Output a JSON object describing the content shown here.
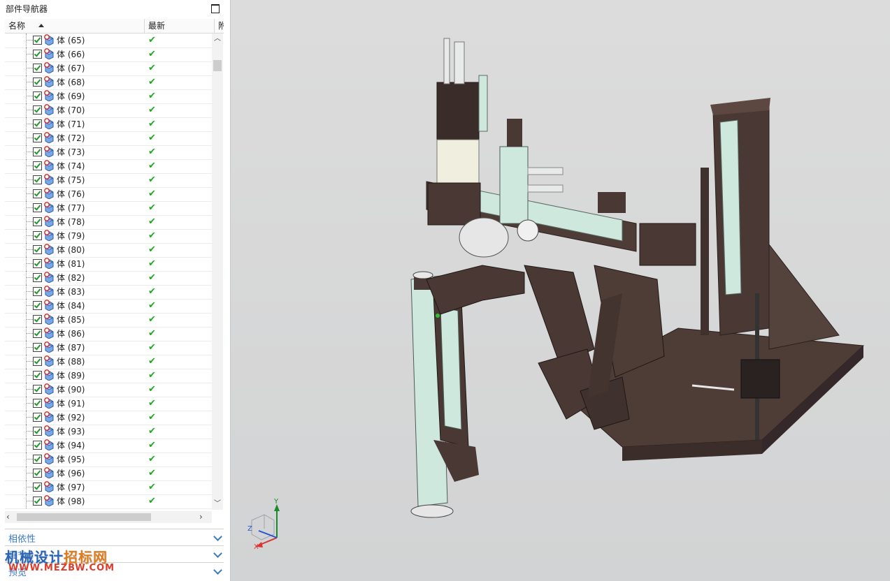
{
  "navigator": {
    "title": "部件导航器",
    "columns": [
      "名称",
      "最新",
      "附"
    ]
  },
  "tree_rows": [
    {
      "label": "体 (65)"
    },
    {
      "label": "体 (66)"
    },
    {
      "label": "体 (67)"
    },
    {
      "label": "体 (68)"
    },
    {
      "label": "体 (69)"
    },
    {
      "label": "体 (70)"
    },
    {
      "label": "体 (71)"
    },
    {
      "label": "体 (72)"
    },
    {
      "label": "体 (73)"
    },
    {
      "label": "体 (74)"
    },
    {
      "label": "体 (75)"
    },
    {
      "label": "体 (76)"
    },
    {
      "label": "体 (77)"
    },
    {
      "label": "体 (78)"
    },
    {
      "label": "体 (79)"
    },
    {
      "label": "体 (80)"
    },
    {
      "label": "体 (81)"
    },
    {
      "label": "体 (82)"
    },
    {
      "label": "体 (83)"
    },
    {
      "label": "体 (84)"
    },
    {
      "label": "体 (85)"
    },
    {
      "label": "体 (86)"
    },
    {
      "label": "体 (87)"
    },
    {
      "label": "体 (88)"
    },
    {
      "label": "体 (89)"
    },
    {
      "label": "体 (90)"
    },
    {
      "label": "体 (91)"
    },
    {
      "label": "体 (92)"
    },
    {
      "label": "体 (93)"
    },
    {
      "label": "体 (94)"
    },
    {
      "label": "体 (95)"
    },
    {
      "label": "体 (96)"
    },
    {
      "label": "体 (97)"
    },
    {
      "label": "体 (98)"
    }
  ],
  "panels": [
    {
      "label": "相依性"
    },
    {
      "label": "细节"
    },
    {
      "label": "预览"
    }
  ],
  "watermark": {
    "line1_a": "机械设计",
    "line1_b": "招标网",
    "line2": "WWW.MEZBW.COM"
  },
  "triad": {
    "x": "X",
    "y": "Y",
    "z": "Z"
  },
  "colors": {
    "panel_link": "#3a78c4",
    "check": "#1fa61f",
    "model_body": "#4e3c37",
    "model_accent": "#cfe8de"
  }
}
